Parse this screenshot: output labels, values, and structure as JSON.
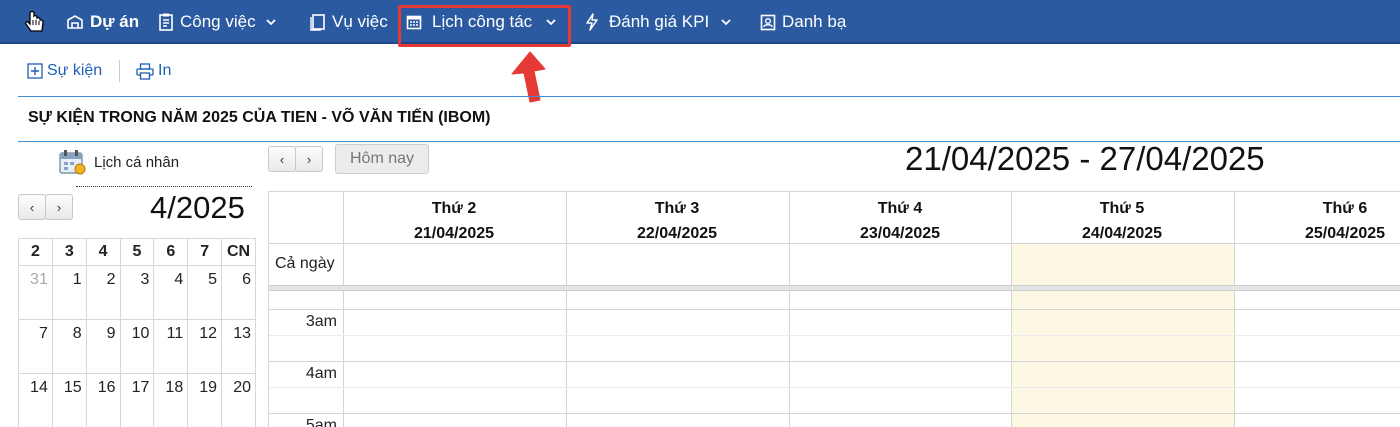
{
  "nav": {
    "items": [
      {
        "label": "Dự án",
        "icon": "projects-icon"
      },
      {
        "label": "Công việc",
        "icon": "tasks-icon"
      },
      {
        "label": "Vụ việc",
        "icon": "cases-icon"
      },
      {
        "label": "Lịch công tác",
        "icon": "calendar-icon"
      },
      {
        "label": "Đánh giá KPI",
        "icon": "lightning-icon"
      },
      {
        "label": "Danh bạ",
        "icon": "contacts-icon"
      }
    ],
    "highlight_color": "#e53935"
  },
  "toolbar": {
    "event_label": "Sự kiện",
    "print_label": "In"
  },
  "section_title": "SỰ KIỆN TRONG NĂM 2025 CỦA TIEN - VÕ VĂN TIẾN (IBOM)",
  "sidebar": {
    "personal_label": "Lịch cá nhân",
    "prev": "‹",
    "next": "›",
    "month": "4/2025",
    "weekdays": [
      "2",
      "3",
      "4",
      "5",
      "6",
      "7",
      "CN"
    ],
    "weeks": [
      [
        "31",
        "1",
        "2",
        "3",
        "4",
        "5",
        "6"
      ],
      [
        "7",
        "8",
        "9",
        "10",
        "11",
        "12",
        "13"
      ],
      [
        "14",
        "15",
        "16",
        "17",
        "18",
        "19",
        "20"
      ]
    ]
  },
  "calendar": {
    "prev": "‹",
    "next": "›",
    "today_label": "Hôm nay",
    "range": "21/04/2025 - 27/04/2025",
    "days": [
      {
        "name": "Thứ 2",
        "date": "21/04/2025"
      },
      {
        "name": "Thứ 3",
        "date": "22/04/2025"
      },
      {
        "name": "Thứ 4",
        "date": "23/04/2025"
      },
      {
        "name": "Thứ 5",
        "date": "24/04/2025"
      },
      {
        "name": "Thứ 6",
        "date": "25/04/2025"
      }
    ],
    "all_day_label": "Cả ngày",
    "times": [
      "3am",
      "4am",
      "5am"
    ],
    "today_color": "#fcf8e3"
  },
  "colors": {
    "nav_bg": "#2c5aa0",
    "link": "#1e5fb4",
    "annotation": "#e53935"
  }
}
